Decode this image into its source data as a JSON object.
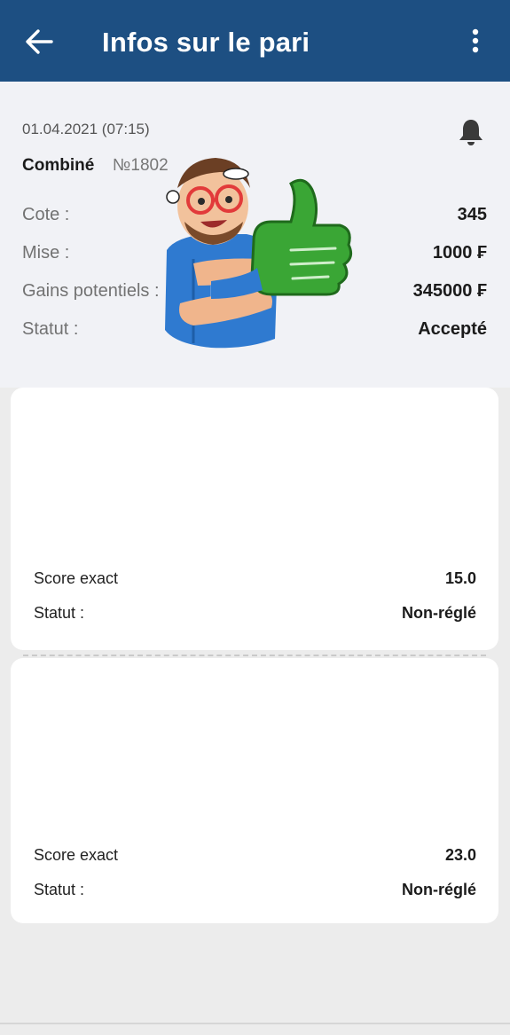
{
  "header": {
    "title": "Infos sur le pari",
    "back_icon": "arrow-left-icon",
    "menu_icon": "more-vertical-icon",
    "color": "#1d4f82"
  },
  "bet": {
    "date": "01.04.2021 (07:15)",
    "type": "Combiné",
    "number": "№1802",
    "notification_icon": "bell-icon",
    "rows": [
      {
        "label": "Cote :",
        "value": "345"
      },
      {
        "label": "Mise :",
        "value": "1000 ₣"
      },
      {
        "label": "Gains potentiels :",
        "value": "345000 ₣"
      },
      {
        "label": "Statut :",
        "value": "Accepté"
      }
    ]
  },
  "events": [
    {
      "market_label": "Score exact",
      "market_value": "15.0",
      "status_label": "Statut :",
      "status_value": "Non-réglé"
    },
    {
      "market_label": "Score exact",
      "market_value": "23.0",
      "status_label": "Statut :",
      "status_value": "Non-réglé"
    }
  ],
  "sticker": {
    "icon": "thumbs-up-mascot-sticker"
  }
}
